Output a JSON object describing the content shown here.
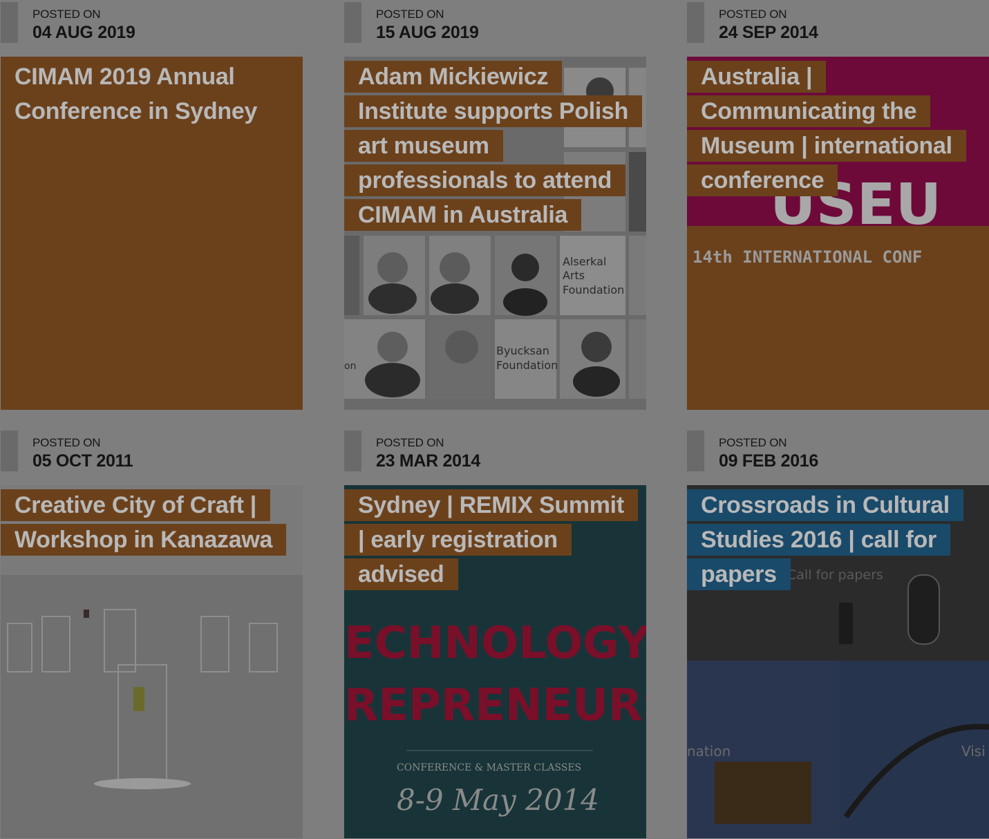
{
  "posts": [
    {
      "posted_label": "POSTED ON",
      "date": "04 AUG 2019",
      "title": "CIMAM 2019 Annual Conference in Sydney"
    },
    {
      "posted_label": "POSTED ON",
      "date": "15 AUG 2019",
      "title": "Adam Mickiewicz Institute supports Polish art museum professionals to attend CIMAM in Australia",
      "image_text": {
        "org1": [
          "Alserkal",
          "Arts",
          "Foundation"
        ],
        "org2": [
          "Byucksan",
          "Foundation"
        ],
        "fragment": "on"
      }
    },
    {
      "posted_label": "POSTED ON",
      "date": "24 SEP 2014",
      "title": "Australia | Communicating the Museum | international conference",
      "image_text": {
        "big": "USEU",
        "small": "14th INTERNATIONAL CONF"
      }
    },
    {
      "posted_label": "POSTED ON",
      "date": "05 OCT 2011",
      "title": "Creative City of Craft | Workshop in Kanazawa"
    },
    {
      "posted_label": "POSTED ON",
      "date": "23 MAR 2014",
      "title": "Sydney | REMIX Summit | early registration advised",
      "image_text": {
        "line1": "ECHNOLOGY",
        "line2": "REPRENEURS",
        "line3": "CONFERENCE & MASTER CLASSES",
        "line4": "8-9 May 2014"
      }
    },
    {
      "posted_label": "POSTED ON",
      "date": "09 FEB 2016",
      "title": "Crossroads in Cultural Studies 2016 | call for papers",
      "image_text": {
        "top": "Call for papers",
        "left": "nation",
        "right": "Visi"
      }
    }
  ],
  "colors": {
    "overlay_bg": "#7e7e7e",
    "title_bg_brown": "#6b411c",
    "title_bg_blue": "#1a4a6a",
    "title_text": "#b8b8b8",
    "card_brown": "#6b411c",
    "magenta": "#7a0a40"
  }
}
